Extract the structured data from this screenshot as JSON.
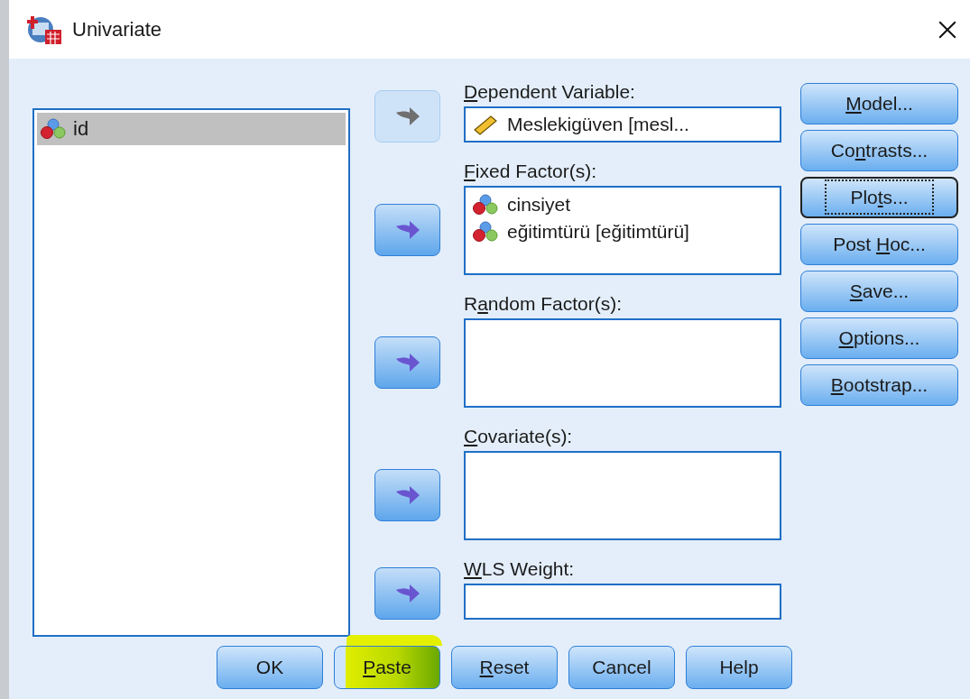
{
  "window": {
    "title": "Univariate"
  },
  "source_list": {
    "items": [
      {
        "name": "id",
        "kind": "nominal",
        "selected": true
      }
    ]
  },
  "targets": [
    {
      "label": {
        "key": "D",
        "after": "ependent Variable:"
      },
      "kind": "single",
      "arrow_enabled": false,
      "items": [
        {
          "name": "Meslekigüven [mesl...",
          "kind": "scale"
        }
      ]
    },
    {
      "label": {
        "key": "F",
        "after": "ixed Factor(s):"
      },
      "kind": "list",
      "arrow_enabled": true,
      "items": [
        {
          "name": "cinsiyet",
          "kind": "nominal"
        },
        {
          "name": "eğitimtürü [eğitimtürü]",
          "kind": "nominal"
        }
      ]
    },
    {
      "label": {
        "before": "R",
        "key": "a",
        "after": "ndom Factor(s):"
      },
      "kind": "list",
      "arrow_enabled": true
    },
    {
      "label": {
        "key": "C",
        "after": "ovariate(s):"
      },
      "kind": "list",
      "arrow_enabled": true
    },
    {
      "label": {
        "key": "W",
        "after": "LS Weight:"
      },
      "kind": "single",
      "arrow_enabled": true
    }
  ],
  "side_buttons": [
    {
      "key": "M",
      "after": "odel...",
      "focused": false
    },
    {
      "before": "Co",
      "key": "n",
      "after": "trasts...",
      "focused": false
    },
    {
      "before": "Plo",
      "key": "t",
      "after": "s...",
      "focused": true
    },
    {
      "before": "Post ",
      "key": "H",
      "after": "oc...",
      "focused": false
    },
    {
      "key": "S",
      "after": "ave...",
      "focused": false
    },
    {
      "key": "O",
      "after": "ptions...",
      "focused": false
    },
    {
      "key": "B",
      "after": "ootstrap...",
      "focused": false
    }
  ],
  "bottom_buttons": [
    {
      "before": "OK",
      "highlighted": false
    },
    {
      "key": "P",
      "after": "aste",
      "highlighted": true
    },
    {
      "key": "R",
      "after": "eset",
      "highlighted": false
    },
    {
      "before": "Cancel",
      "highlighted": false
    },
    {
      "before": "Help",
      "highlighted": false
    }
  ]
}
